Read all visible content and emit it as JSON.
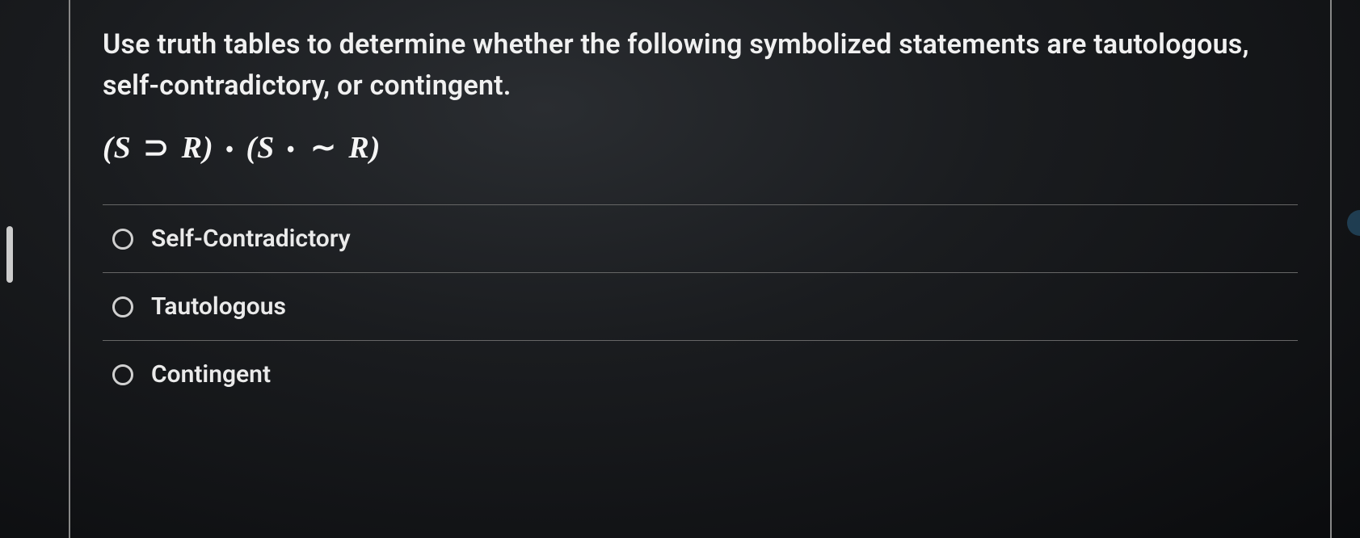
{
  "question": {
    "instruction": "Use truth tables to determine whether the following symbolized statements are tautologous, self-contradictory, or contingent.",
    "formula": "(S ⊃ R) • (S • ∼ R)"
  },
  "options": [
    {
      "label": "Self-Contradictory"
    },
    {
      "label": "Tautologous"
    },
    {
      "label": "Contingent"
    }
  ]
}
